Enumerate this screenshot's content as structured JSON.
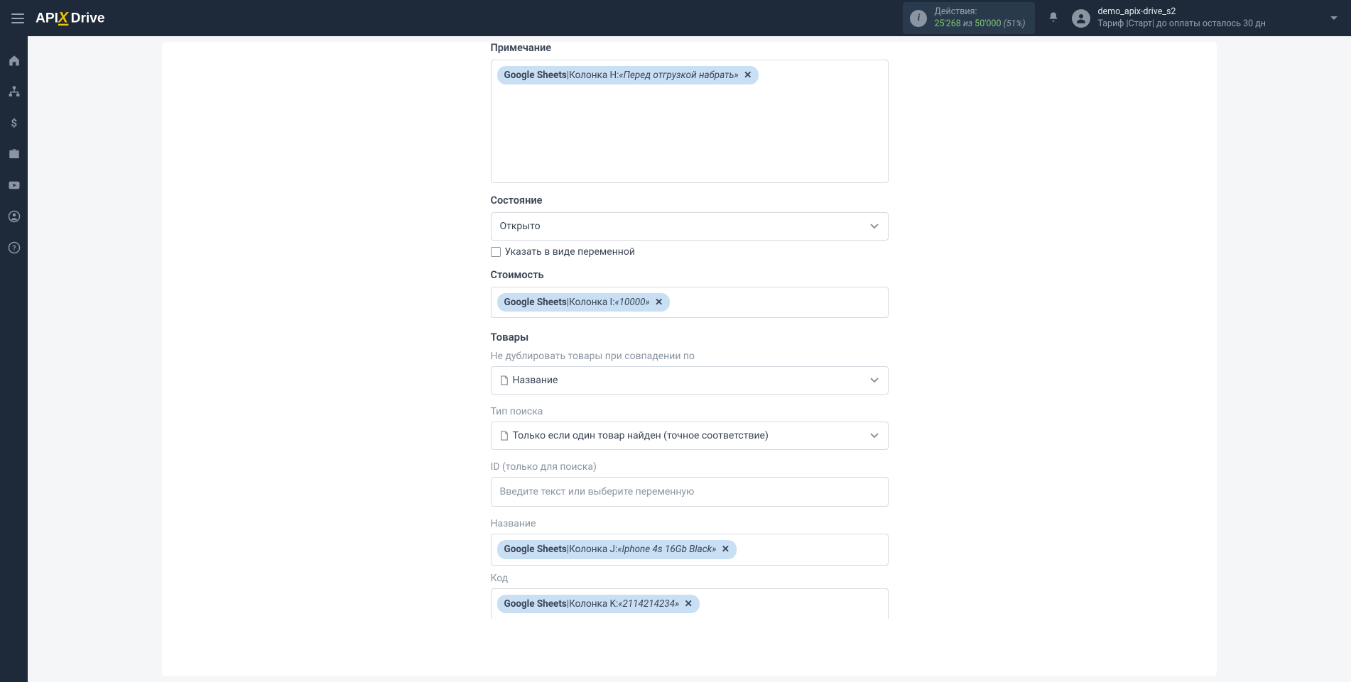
{
  "header": {
    "actions_label": "Действия:",
    "actions_used": "25'268",
    "actions_from": "из",
    "actions_total": "50'000",
    "actions_pct": "(51%)",
    "user_name": "demo_apix-drive_s2",
    "user_tariff": "Тариф |Старт| до оплаты осталось 30 дн"
  },
  "form": {
    "note_label": "Примечание",
    "note_token": {
      "source": "Google Sheets",
      "separator": " | ",
      "col": "Колонка H: ",
      "val": "«Перед отгрузкой набрать»"
    },
    "state_label": "Состояние",
    "state_value": "Открыто",
    "state_checkbox": "Указать в виде переменной",
    "cost_label": "Стоимость",
    "cost_token": {
      "source": "Google Sheets",
      "separator": " | ",
      "col": "Колонка I: ",
      "val": "«10000»"
    },
    "products_title": "Товары",
    "dedup_label": "Не дублировать товары при совпадении по",
    "dedup_value": "Название",
    "search_type_label": "Тип поиска",
    "search_type_value": "Только если один товар найден (точное соответствие)",
    "id_label": "ID (только для поиска)",
    "id_placeholder": "Введите текст или выберите переменную",
    "name_label": "Название",
    "name_token": {
      "source": "Google Sheets",
      "separator": " | ",
      "col": "Колонка J: ",
      "val": "«Iphone 4s 16Gb Black»"
    },
    "code_label": "Код",
    "code_token": {
      "source": "Google Sheets",
      "separator": " | ",
      "col": "Колонка K: ",
      "val": "«2114214234»"
    }
  }
}
